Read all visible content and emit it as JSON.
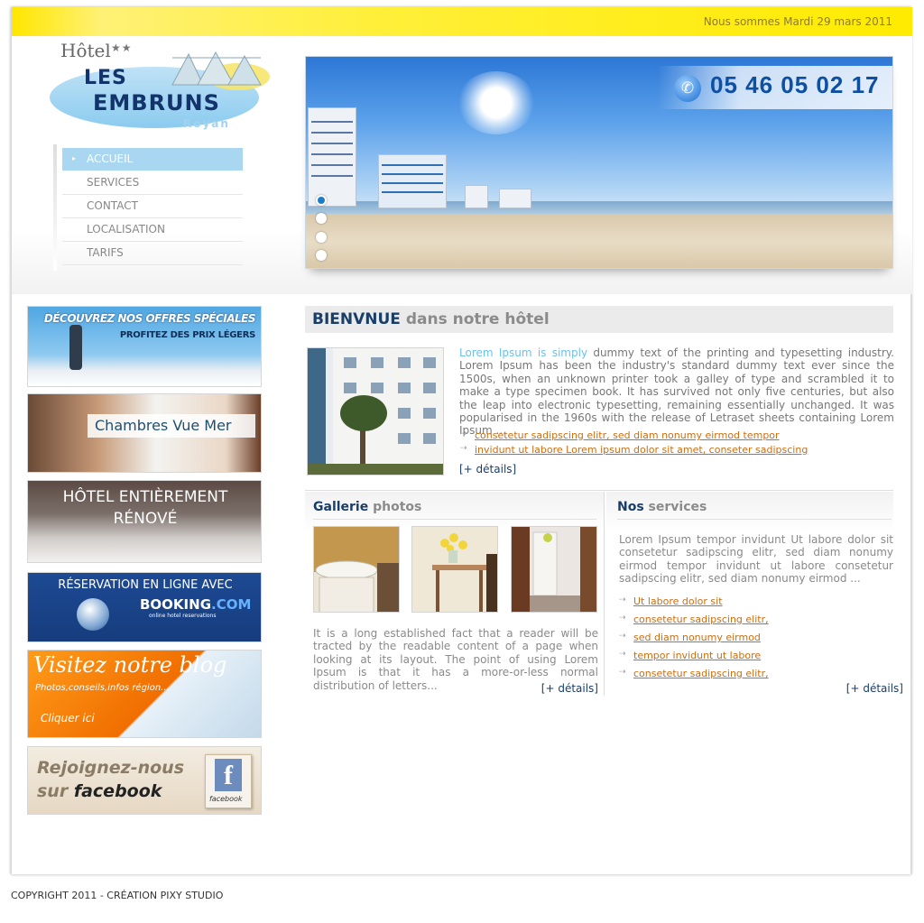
{
  "topbar": {
    "date": "Nous sommes Mardi 29 mars 2011"
  },
  "logo": {
    "hotel": "Hôtel",
    "stars": "★★",
    "les": "LES",
    "embruns": "EMBRUNS",
    "royan": "Royan"
  },
  "nav": {
    "items": [
      {
        "label": "ACCUEIL",
        "active": true
      },
      {
        "label": "SERVICES",
        "active": false
      },
      {
        "label": "CONTACT",
        "active": false
      },
      {
        "label": "LOCALISATION",
        "active": false
      },
      {
        "label": "TARIFS",
        "active": false
      }
    ]
  },
  "banner": {
    "phone": "05 46 05 02 17",
    "phone_icon": "phone-icon",
    "active_slide": 1,
    "slide_count": 4
  },
  "promos": {
    "offres": {
      "line1": "DÉCOUVREZ NOS OFFRES SPÉCIALES",
      "line2": "PROFITEZ DES PRIX LÉGERS"
    },
    "chambres": {
      "label": "Chambres Vue Mer"
    },
    "renove": {
      "line1": "HÔTEL ENTIÈREMENT",
      "line2": "RÉNOVÉ"
    },
    "booking": {
      "line1": "RÉSERVATION EN LIGNE AVEC",
      "brand": "BOOKING",
      "brand_suffix": ".COM",
      "tagline": "online hotel reservations"
    },
    "blog": {
      "line1": "Visitez notre blog",
      "line2": "Photos,conseils,infos région...",
      "line3": "Cliquer ici"
    },
    "facebook": {
      "line1": "Rejoignez-nous",
      "line2_prefix": "sur ",
      "line2_brand": "facebook",
      "badge_letter": "f",
      "badge_text": "facebook"
    }
  },
  "welcome": {
    "title_main": "BIENVNUE",
    "title_sub": " dans notre hôtel",
    "text_highlight": "Lorem Ipsum is simply",
    "text_body": " dummy text of the printing and typesetting industry. Lorem Ipsum has been the industry's standard dummy text ever since the 1500s, when an unknown printer took a galley of type and scrambled it to make a type specimen book. It has survived not only five centuries, but also the leap into electronic typesetting, remaining essentially unchanged. It was popularised in the 1960s with the release of Letraset sheets containing Lorem Ipsum ...",
    "links": [
      "consetetur sadipscing elitr, sed diam nonumy eirmod tempor",
      "invidunt ut labore Lorem ipsum dolor sit amet, conseter sadipscing"
    ],
    "details": "[+ détails]"
  },
  "gallery": {
    "title_main": "Gallerie",
    "title_sub": " photos",
    "text": "It is a long established fact that a reader will be tracted by the readable content of a page when looking at its layout. The point of using Lorem Ipsum is that it has a more-or-less normal distribution of letters...",
    "details": "[+ détails]"
  },
  "services": {
    "title_main": "Nos",
    "title_sub": " services",
    "text": "Lorem Ipsum tempor invidunt Ut labore dolor sit consetetur sadipscing elitr, sed diam nonumy eirmod tempor invidunt ut labore consetetur sadipscing elitr, sed diam nonumy eirmod ...",
    "links": [
      "Ut labore dolor sit",
      "consetetur sadipscing elitr,",
      "sed diam nonumy eirmod",
      "tempor invidunt ut labore",
      "consetetur sadipscing elitr,"
    ],
    "details": "[+ détails]"
  },
  "footer": {
    "text": "COPYRIGHT 2011 - CRÉATION PIXY STUDIO"
  },
  "colors": {
    "topbar": "#ffeb00",
    "nav_active": "#a9d7f1",
    "heading": "#1a3e6a",
    "link": "#cc6d10",
    "highlight": "#6cc1ec"
  }
}
